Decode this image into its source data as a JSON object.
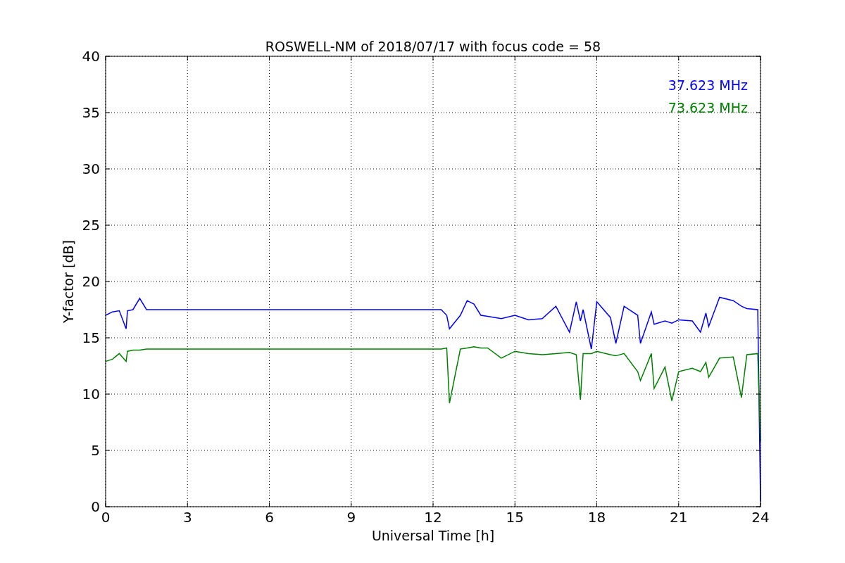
{
  "chart_data": {
    "type": "line",
    "title": "ROSWELL-NM of 2018/07/17 with focus code = 58",
    "xlabel": "Universal Time [h]",
    "ylabel": "Y-factor [dB]",
    "x": [
      0,
      0.25,
      0.5,
      0.75,
      0.8,
      1,
      1.25,
      1.5,
      3,
      6,
      9,
      12.3,
      12.5,
      12.6,
      13,
      13.25,
      13.5,
      13.75,
      14,
      14.5,
      15,
      15.5,
      16,
      16.5,
      17,
      17.25,
      17.4,
      17.5,
      17.8,
      18,
      18.5,
      18.7,
      19,
      19.5,
      19.6,
      20,
      20.1,
      20.5,
      20.75,
      21,
      21.5,
      21.8,
      22,
      22.1,
      22.5,
      23,
      23.3,
      23.5,
      23.9,
      24
    ],
    "series": [
      {
        "name": "37.623 MHz",
        "color": "#0000ff",
        "values": [
          17.0,
          17.3,
          17.4,
          15.8,
          17.4,
          17.5,
          18.5,
          17.5,
          17.5,
          17.5,
          17.5,
          17.5,
          17.0,
          15.8,
          17.0,
          18.3,
          18.0,
          17.0,
          16.9,
          16.7,
          17.0,
          16.6,
          16.7,
          17.8,
          15.5,
          18.2,
          16.5,
          17.5,
          14.0,
          18.2,
          16.8,
          14.5,
          17.8,
          17.0,
          14.5,
          17.3,
          16.2,
          16.5,
          16.3,
          16.6,
          16.5,
          15.5,
          17.2,
          16.0,
          18.6,
          18.3,
          17.8,
          17.6,
          17.5,
          0.5
        ]
      },
      {
        "name": "73.623 MHz",
        "color": "#008000",
        "values": [
          12.9,
          13.1,
          13.6,
          12.9,
          13.8,
          13.9,
          13.9,
          14.0,
          14.0,
          14.0,
          14.0,
          14.0,
          14.1,
          9.2,
          14.0,
          14.1,
          14.2,
          14.1,
          14.1,
          13.2,
          13.8,
          13.6,
          13.5,
          13.6,
          13.7,
          13.5,
          9.5,
          13.6,
          13.6,
          13.8,
          13.5,
          13.4,
          13.6,
          12.0,
          11.2,
          13.6,
          10.5,
          12.4,
          9.4,
          12.0,
          12.3,
          12.0,
          12.8,
          11.5,
          13.2,
          13.3,
          9.7,
          13.5,
          13.6,
          5.8
        ]
      }
    ],
    "xlim": [
      0,
      24
    ],
    "ylim": [
      0,
      40
    ],
    "xticks": [
      0,
      3,
      6,
      9,
      12,
      15,
      18,
      21,
      24
    ],
    "yticks": [
      0,
      5,
      10,
      15,
      20,
      25,
      30,
      35,
      40
    ],
    "grid": true
  }
}
